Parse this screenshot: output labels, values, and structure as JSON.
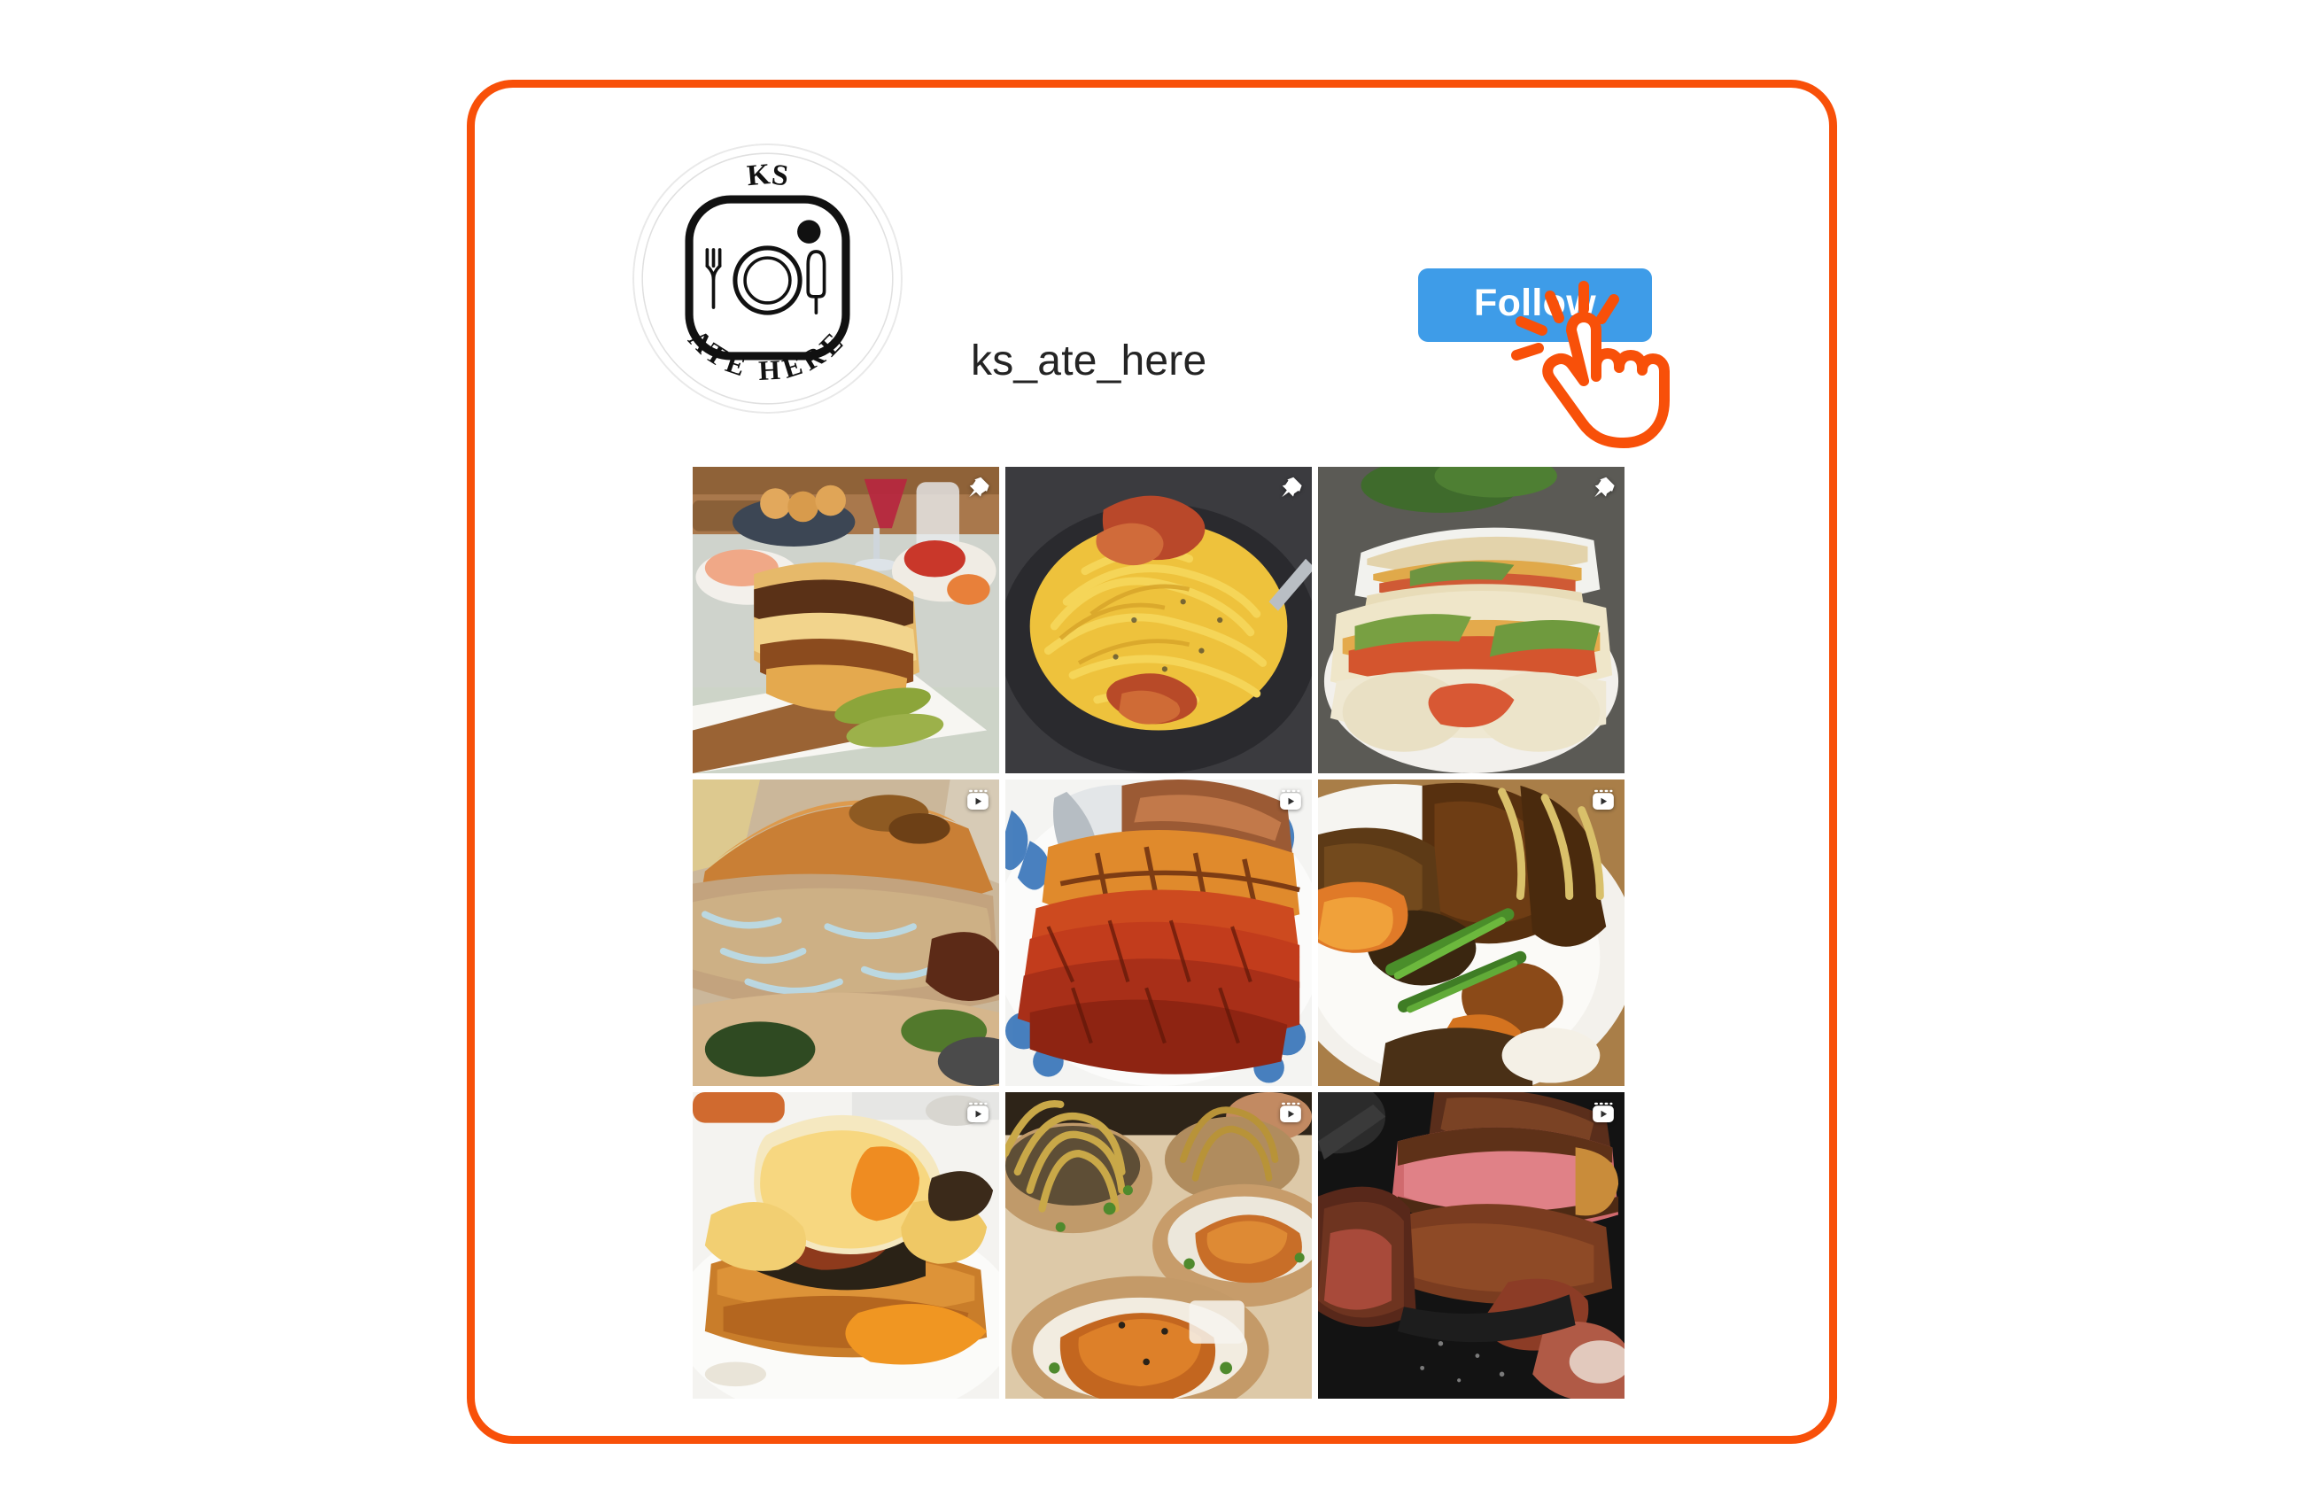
{
  "card": {
    "border_color": "#f85009",
    "background": "#ffffff"
  },
  "profile": {
    "username": "ks_ate_here",
    "avatar": {
      "name": "ks-ate-here-logo",
      "top_text": "KS",
      "bottom_text": "ATE HERE",
      "inner_icons": [
        "fork-icon",
        "plate-icon",
        "knife-icon",
        "camera-shutter-dot"
      ]
    },
    "follow_button": {
      "label": "Follow",
      "color": "#3e9ce8",
      "text_color": "#ffffff",
      "state": "not-following"
    },
    "cursor": {
      "name": "pointing-hand-click-cursor",
      "color": "#f85009"
    }
  },
  "grid": {
    "columns": 3,
    "rows": 3,
    "posts": [
      {
        "index": 1,
        "alt": "Grilled cheese sandwich with pickles on wooden board",
        "badge": "pin-icon",
        "badge_label": "Pinned post"
      },
      {
        "index": 2,
        "alt": "Spaghetti carbonara with crispy bacon in a dark pan",
        "badge": "pin-icon",
        "badge_label": "Pinned post"
      },
      {
        "index": 3,
        "alt": "Bagel sandwich with smoked salmon, avocado and egg",
        "badge": "pin-icon",
        "badge_label": "Pinned post"
      },
      {
        "index": 4,
        "alt": "Cheeseburger with melted cheese sauce close-up",
        "badge": "reels-icon",
        "badge_label": "Reel"
      },
      {
        "index": 5,
        "alt": "Char siu BBQ pork and roast pork belly on blue and white platter",
        "badge": "reels-icon",
        "badge_label": "Reel"
      },
      {
        "index": 6,
        "alt": "Grilled lamb chops over rice with green chillies",
        "badge": "reels-icon",
        "badge_label": "Reel"
      },
      {
        "index": 7,
        "alt": "Eggs benedict with hollandaise and runny yolk on toast",
        "badge": "reels-icon",
        "badge_label": "Reel"
      },
      {
        "index": 8,
        "alt": "Noodle and rice bowls with glazed chicken in kraft bowls",
        "badge": "reels-icon",
        "badge_label": "Reel"
      },
      {
        "index": 9,
        "alt": "Sliced medium-rare steak on a dark grill plate",
        "badge": "reels-icon",
        "badge_label": "Reel"
      }
    ]
  }
}
